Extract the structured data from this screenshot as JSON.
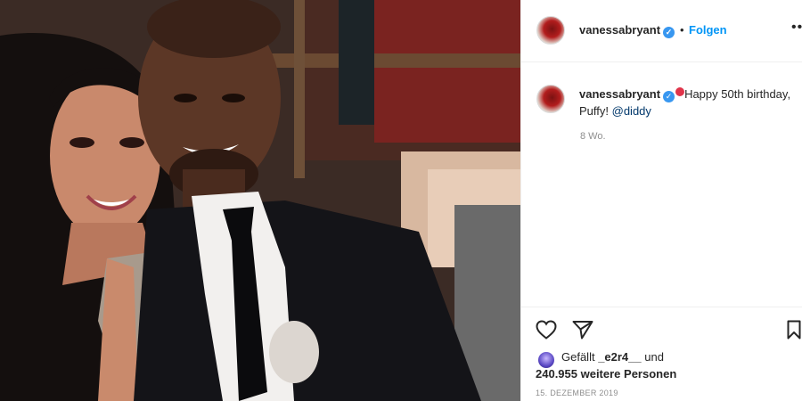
{
  "post": {
    "username": "vanessabryant",
    "follow_label": "Folgen",
    "separator": "•",
    "more_label": "•••",
    "caption_username": "vanessabryant",
    "caption_text": "Happy 50th birthday, Puffy! ",
    "caption_mention": "@diddy",
    "time_ago": "8 Wo.",
    "likes_prefix": "Gefällt ",
    "likes_user": "_e2r4__",
    "likes_and": " und",
    "likes_count": "240.955 weitere Personen",
    "date": "15. DEZEMBER 2019"
  },
  "icons": {
    "verified": "verified-badge-icon",
    "like": "heart-icon",
    "share": "paper-plane-icon",
    "save": "bookmark-icon",
    "more": "more-options-icon",
    "balloon": "balloon-emoji-icon"
  },
  "colors": {
    "link_blue": "#0095f6",
    "verified_blue": "#3897f0",
    "mention": "#00376b",
    "muted": "#8e8e8e",
    "text": "#262626"
  }
}
